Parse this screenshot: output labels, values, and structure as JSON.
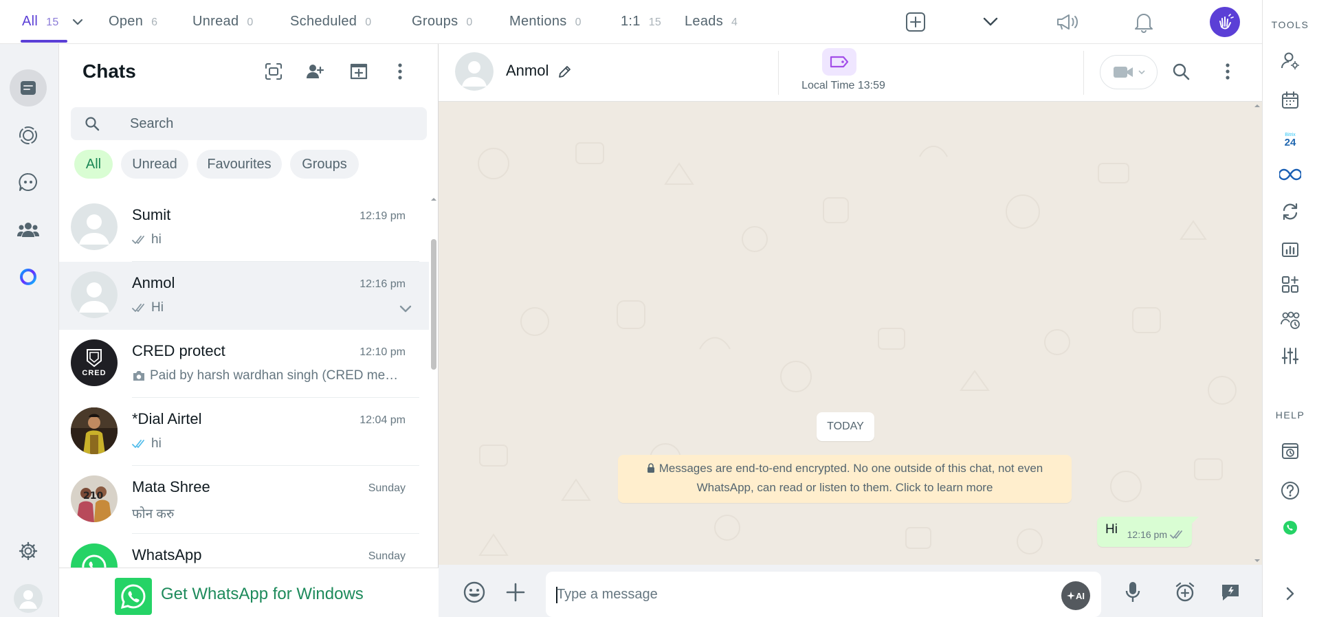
{
  "filters": {
    "tabs": [
      {
        "label": "All",
        "count": "15"
      },
      {
        "label": "Open",
        "count": "6"
      },
      {
        "label": "Unread",
        "count": "0"
      },
      {
        "label": "Scheduled",
        "count": "0"
      },
      {
        "label": "Groups",
        "count": "0"
      },
      {
        "label": "Mentions",
        "count": "0"
      },
      {
        "label": "1:1",
        "count": "15"
      },
      {
        "label": "Leads",
        "count": "4"
      }
    ],
    "active": "All"
  },
  "chats": {
    "title": "Chats",
    "search_placeholder": "Search",
    "chips": [
      "All",
      "Unread",
      "Favourites",
      "Groups"
    ],
    "items": [
      {
        "name": "Sumit",
        "time": "12:19 pm",
        "preview": "hi",
        "tick": "read-grey"
      },
      {
        "name": "Anmol",
        "time": "12:16 pm",
        "preview": "Hi",
        "tick": "read-grey"
      },
      {
        "name": "CRED protect",
        "time": "12:10 pm",
        "preview": "Paid by harsh wardhan singh (CRED memb…",
        "tick": "camera",
        "avatar_text": "CRED"
      },
      {
        "name": "*Dial Airtel",
        "time": "12:04 pm",
        "preview": "hi",
        "tick": "read-blue"
      },
      {
        "name": "Mata Shree",
        "time": "Sunday",
        "preview": "फोन करु",
        "tick": "none"
      },
      {
        "name": "WhatsApp",
        "time": "Sunday",
        "preview": "",
        "tick": "none"
      }
    ],
    "promo": "Get WhatsApp for Windows"
  },
  "conversation": {
    "contact_name": "Anmol",
    "local_time": "Local Time 13:59",
    "today_label": "TODAY",
    "e2e_notice": "Messages are end-to-end encrypted. No one outside of this chat, not even WhatsApp, can read or listen to them. Click to learn more",
    "messages": [
      {
        "text": "Hi",
        "time": "12:16 pm",
        "outgoing": true
      }
    ],
    "composer_placeholder": "Type a message",
    "ai_label": "AI"
  },
  "tools": {
    "tools_label": "TOOLS",
    "help_label": "HELP",
    "bitrix_label": "24"
  },
  "colors": {
    "accent": "#5b3fd6",
    "whatsapp_green": "#25d366",
    "chip_active_bg": "#d9fdd3",
    "chat_bg": "#efeae2",
    "bubble_out": "#d9fdd3",
    "notice_bg": "#ffeecd"
  }
}
